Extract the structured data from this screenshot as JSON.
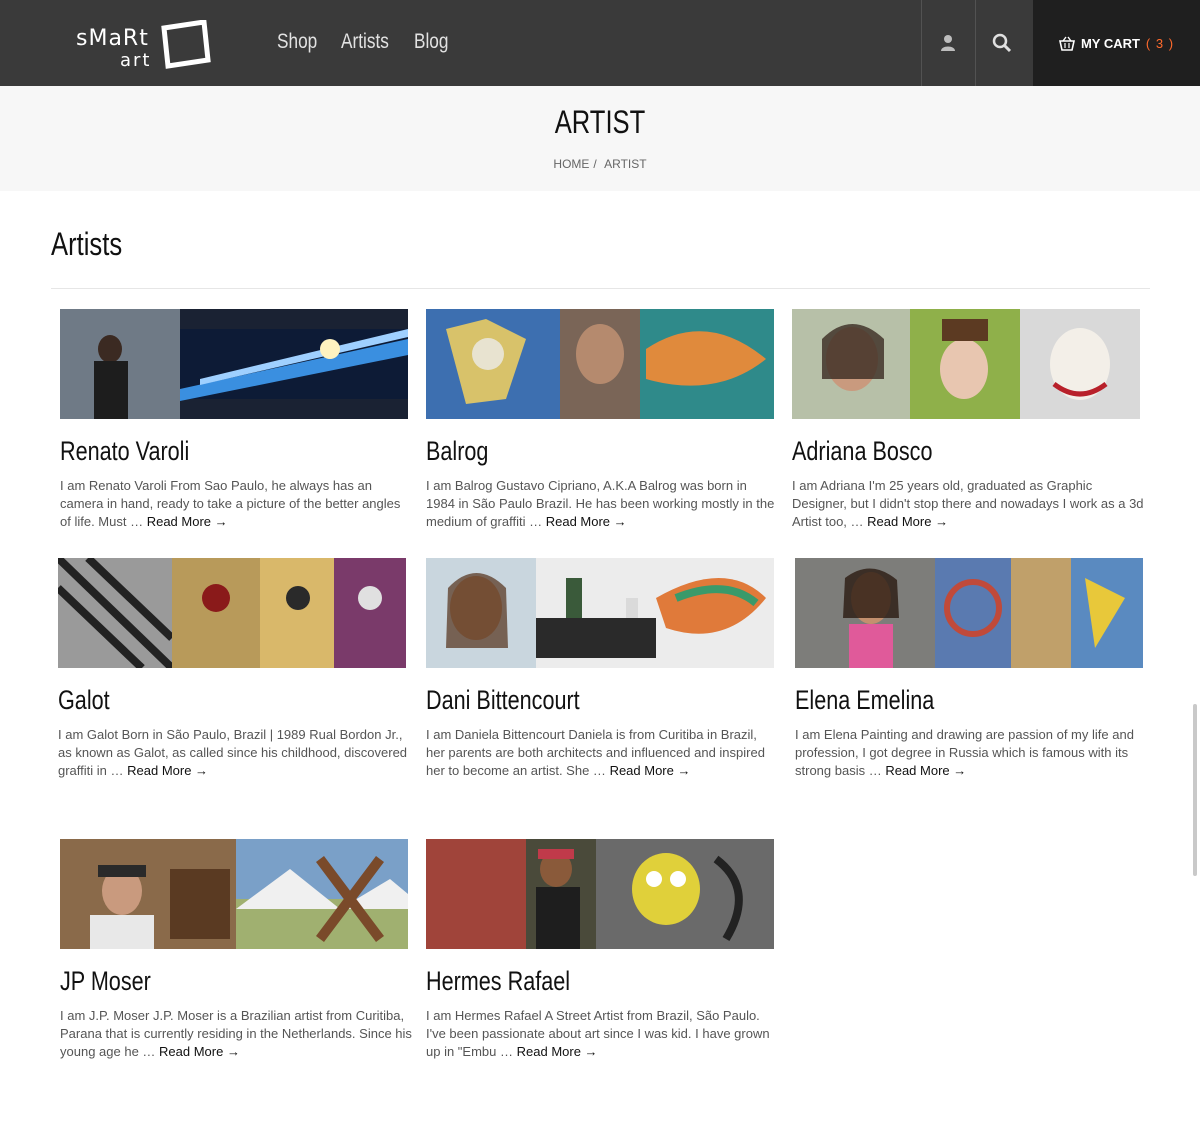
{
  "header": {
    "logo_word": "sMaRt",
    "logo_sub": "art",
    "nav": [
      "Shop",
      "Artists",
      "Blog"
    ],
    "cart_label": "MY CART",
    "cart_count": "( 3 )",
    "accent": "#ff6a2c",
    "icons": [
      "user-icon",
      "search-icon",
      "basket-icon"
    ]
  },
  "page": {
    "title": "ARTIST",
    "breadcrumb": [
      "HOME",
      "/",
      "ARTIST"
    ]
  },
  "section": {
    "title": "Artists"
  },
  "read_more": "Read More →",
  "artists": [
    {
      "name": "Renato Varoli",
      "excerpt": "I am Renato Varoli From Sao Paulo, he always has an camera in hand, ready to take a picture of the better angles of life. Must …"
    },
    {
      "name": "Balrog",
      "excerpt": "I am Balrog Gustavo Cipriano, A.K.A Balrog was born in 1984 in São Paulo Brazil. He has been working mostly in the medium of graffiti …"
    },
    {
      "name": "Adriana Bosco",
      "excerpt": "I am Adriana I'm 25 years old, graduated as Graphic Designer, but I didn't stop there and nowadays I work as a 3d Artist too, …"
    },
    {
      "name": "Galot",
      "excerpt": "I am Galot Born in São Paulo, Brazil | 1989 Rual Bordon Jr., as known as Galot, as called since his childhood, discovered graffiti in …"
    },
    {
      "name": "Dani Bittencourt",
      "excerpt": "I am Daniela Bittencourt Daniela is from Curitiba in Brazil, her parents are both architects and influenced and inspired her to become an artist. She …"
    },
    {
      "name": "Elena Emelina",
      "excerpt": "I am Elena Painting and drawing are passion of my life and profession, I got degree in Russia which is famous with its strong basis …"
    },
    {
      "name": "JP Moser",
      "excerpt": "I am J.P. Moser J.P. Moser is a Brazilian artist from Curitiba, Parana that is currently residing in the Netherlands. Since his young age he …"
    },
    {
      "name": "Hermes Rafael",
      "excerpt": "I am Hermes Rafael A Street Artist from Brazil, São Paulo. I've been passionate about art since I was kid. I have grown up in \"Embu …"
    }
  ]
}
